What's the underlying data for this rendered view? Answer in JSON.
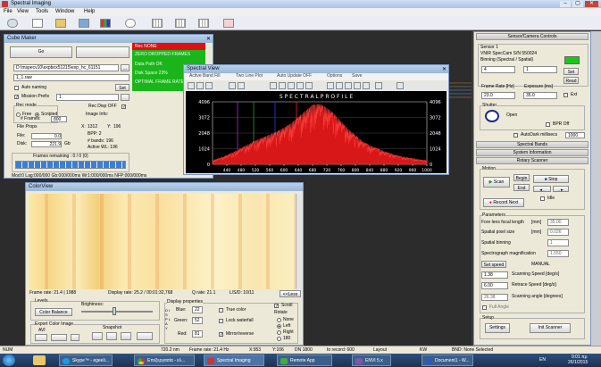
{
  "app": {
    "title": "Spectral Imaging",
    "menu": [
      "File",
      "View",
      "Tools",
      "Window",
      "Help"
    ]
  },
  "cube": {
    "title": "Cube Maker",
    "go": "Go",
    "path": "D:\\mspecv10\\expbox51215\\exp_hc_61151",
    "file_name": "1_1.raw",
    "set": "Set",
    "auto_naming": "Auto naming",
    "mission_prefix": "Mission Prefix",
    "prefix_val": "1",
    "rec_mode": "Rec mode",
    "free": "Free",
    "scripted": "Scripted",
    "rec_disp_off": "Rec Disp OFF",
    "frames_lbl": "# Frames:",
    "frames_val": "800",
    "image_info": "Image Info:",
    "file_props": "File Props",
    "x_lbl": "X:",
    "x_val": "1312",
    "y_lbl": "Y:",
    "y_val": "196",
    "bpp": "BPP: 2",
    "bands": "# bands: 196",
    "active_wl": "Active WL: 196",
    "file_lbl": "File:",
    "file_val": "0.0",
    "disk_lbl": "Disk:",
    "disk_val": "221.9",
    "gb": "Gb",
    "frames_remaining": "Frames remaining : 0 / 0 (0)",
    "status": "Mod:0 Lag:000/000 Gb:000/000ms Wr1:000/000ms NFP:000/000ms"
  },
  "alerts": [
    "ZERO DROPPED FRAMES",
    "Data Path OK",
    "Disk Space 23%",
    "OPTIMAL FRAME RATE"
  ],
  "alert_top": "Rec NONE",
  "spectral": {
    "title": "Spectral View",
    "menu": [
      "Active Band Fill",
      "Two Line Plot",
      "Auto Update OFF",
      "Options",
      "Save"
    ],
    "plot_title": "S P E C T R A L   P R O F I L E"
  },
  "chart_data": {
    "type": "line",
    "title": "S P E C T R A L   P R O F I L E",
    "xlabel": "",
    "ylabel": "",
    "xlim": [
      400,
      1000
    ],
    "ylim": [
      0,
      4096
    ],
    "x_ticks": [
      440,
      480,
      520,
      560,
      600,
      640,
      680,
      720,
      760,
      800,
      840,
      880,
      920,
      960,
      1000
    ],
    "y_ticks": [
      "4096",
      "3072",
      "2048",
      "1024",
      "0"
    ],
    "band_markers": [
      {
        "x": 515,
        "color": "#2a7a2a"
      },
      {
        "x": 575,
        "color": "#2a2ac0"
      },
      {
        "x": 635,
        "color": "#c02020"
      },
      {
        "x": 470,
        "color": "#7a2ab0"
      }
    ],
    "x": [
      400,
      420,
      440,
      460,
      480,
      500,
      520,
      540,
      560,
      580,
      600,
      620,
      640,
      660,
      680,
      700,
      720,
      740,
      760,
      780,
      800,
      820,
      840,
      860,
      880,
      900,
      920,
      940,
      960,
      980,
      1000
    ],
    "values": [
      250,
      400,
      600,
      800,
      1050,
      1300,
      1550,
      1750,
      1950,
      2150,
      2400,
      2700,
      3100,
      3500,
      3900,
      3950,
      3700,
      3300,
      2800,
      2300,
      1900,
      1500,
      1250,
      1050,
      850,
      700,
      550,
      450,
      380,
      300,
      250
    ]
  },
  "color_view": {
    "title": "ColorView",
    "frame_rate": "Frame rate: 21.4 | 1988",
    "display_rate": "Display rate: 25.2 / 00:01:32,768",
    "q_rate": "Q rate: 21.1",
    "ld": "L/S/D: 10/11",
    "less": "<<Less",
    "levels": "Levels",
    "brightness": "Brightness:",
    "color_balance": "Color Balance",
    "export": "Export Color Image",
    "avi": "AVI",
    "snapshot": "Snapshot",
    "display_props": "Display properties",
    "blue_lbl": "Blue:",
    "blue_val": "22",
    "green_lbl": "Green:",
    "green_val": "52",
    "red_lbl": "Red:",
    "red_val": "81",
    "true_color": "True color",
    "lock_waterfall": "Lock waterfall",
    "mirror": "Mirror/reverse",
    "scroll": "Scroll",
    "rotate": "Rotate",
    "none": "None",
    "left": "Left",
    "right": "Right",
    "r180": "180",
    "display_v": "D I S P L A Y"
  },
  "sensor": {
    "title": "Sensor/Camera Controls",
    "sensor1": "Sensor 1",
    "camera": "VNIR SpecCam S/N 550024",
    "binning": "Binning (Spectral / Spatial)",
    "bin1": "4",
    "bin2": "1",
    "set": "Set",
    "read": "Read",
    "frame_rate": "Frame Rate [Hz]",
    "exposure": "Exposure [ms]",
    "fr_val": "23.0",
    "exp_val": "35.0",
    "ext": "Ext",
    "shutter": "Shutter",
    "open": "Open",
    "bpr_off": "BPR Off",
    "autodark": "AutoDark millisecs",
    "autodark_val": "1000",
    "spectral_bands": "Spectral Bands",
    "system_info": "System Information",
    "rotary": "Rotary Scanner",
    "motion": "Motion",
    "scan": "Scan",
    "begin": "Begin",
    "end": "End",
    "stop": "Stop",
    "idle": "Idle",
    "record_next": "Record Next",
    "params": "Parameters",
    "fore_lens": "Fore lens focal length",
    "fore_unit": "[mm]",
    "fore_val": "35.00",
    "spatial_px": "Spatial pixel size",
    "spatial_unit": "[mm]",
    "spatial_val": "0.026",
    "spatial_bin": "Spatial binning",
    "spatial_bin_val": "1",
    "spectro_mag": "Spectrograph magnification",
    "spectro_val": "1.550",
    "set_speed": "Set speed",
    "manual": "MANUAL",
    "scan_speed_val": "1.38",
    "scan_speed": "Scanning Speed [deg/s]",
    "retrace_val": "6.00",
    "retrace": "Retrace Speed [deg/s]",
    "scan_angle_val": "26.38",
    "scan_angle": "Scanning angle [degrees]",
    "full_angle": "Full Angle",
    "setup": "Setup",
    "settings": "Settings",
    "init_scanner": "Init Scanner"
  },
  "statusbar": {
    "num": "NUM",
    "frame": "720.2 nm",
    "frame_rate": "Frame rate: 21.4 Hz",
    "x": "X:953",
    "y": "Y:106",
    "dn": "DN 1800",
    "rec": "to record: 600",
    "layout": "Layout",
    "kw": "KW",
    "bnd": "BND: None Selected"
  },
  "taskbar": {
    "items": [
      "Skype™ - egeeli...",
      "Επεξεργασία - ελ...",
      "Spectral Imaging",
      "Remote App",
      "ENVI 5.x",
      "Document1 - W..."
    ],
    "lang": "EN",
    "time": "9:01 πμ",
    "date": "26/1/2015"
  }
}
